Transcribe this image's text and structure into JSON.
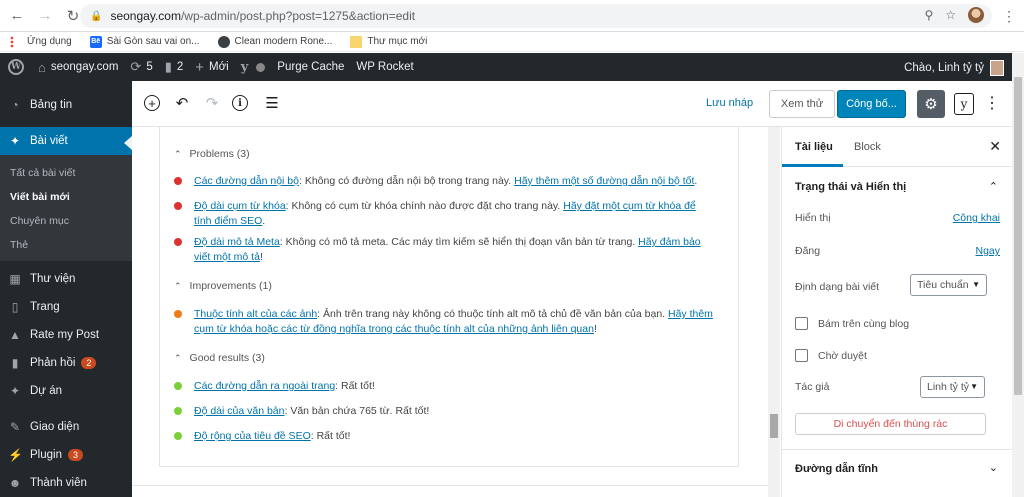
{
  "browser": {
    "url_domain": "seongay.com",
    "url_path": "/wp-admin/post.php?post=1275&action=edit",
    "bookmarks": [
      {
        "label": "Ứng dụng",
        "icon": "apps-grid-icon"
      },
      {
        "label": "Sài Gòn sau vai on...",
        "icon": "be-site-icon"
      },
      {
        "label": "Clean modern Rone...",
        "icon": "globe-icon"
      },
      {
        "label": "Thư mục mới",
        "icon": "folder-icon"
      }
    ]
  },
  "adminbar": {
    "site_name": "seongay.com",
    "updates_count": "5",
    "comments_count": "2",
    "new_label": "Mới",
    "purge_cache": "Purge Cache",
    "wp_rocket": "WP Rocket",
    "greeting": "Chào, Linh tỷ tỷ"
  },
  "sidebar": {
    "items": [
      {
        "label": "Bảng tin",
        "icon": "dashboard-icon"
      },
      {
        "label": "Bài viết",
        "icon": "pin-icon"
      },
      {
        "label": "Thư viện",
        "icon": "media-icon"
      },
      {
        "label": "Trang",
        "icon": "page-icon"
      },
      {
        "label": "Rate my Post",
        "icon": "thumbs-up-icon"
      },
      {
        "label": "Phản hồi",
        "icon": "comment-icon",
        "badge": "2"
      },
      {
        "label": "Dự án",
        "icon": "pin-icon"
      },
      {
        "label": "Giao diện",
        "icon": "brush-icon"
      },
      {
        "label": "Plugin",
        "icon": "plugin-icon",
        "badge": "3"
      },
      {
        "label": "Thành viên",
        "icon": "users-icon"
      }
    ],
    "submenu": [
      "Tất cả bài viết",
      "Viết bài mới",
      "Chuyên mục",
      "Thẻ"
    ]
  },
  "toolbar": {
    "save_draft": "Lưu nháp",
    "preview": "Xem thử",
    "publish": "Công bố..."
  },
  "seo": {
    "problems_title": "Problems (3)",
    "problems": [
      {
        "link": "Các đường dẫn nội bộ",
        "text": ": Không có đường dẫn nội bộ trong trang này. ",
        "action": "Hãy thêm một số đường dẫn nội bộ tốt",
        "end": "."
      },
      {
        "link": "Độ dài cụm từ khóa",
        "text": ": Không có cụm từ khóa chính nào được đặt cho trang này. ",
        "action": "Hãy đặt một cụm từ khóa để tính điểm SEO",
        "end": "."
      },
      {
        "link": "Độ dài mô tả Meta",
        "text": ": Không có mô tả meta. Các máy tìm kiếm sẽ hiển thị đoạn văn bản từ trang. ",
        "action": "Hãy đảm bảo viết một mô tả",
        "end": "!"
      }
    ],
    "improvements_title": "Improvements (1)",
    "improvements": [
      {
        "link": "Thuộc tính alt của các ảnh",
        "text": ": Ảnh trên trang này không có thuộc tính alt mô tả chủ đề văn bản của bạn. ",
        "action": "Hãy thêm cụm từ khóa hoặc các từ đồng nghĩa trong các thuộc tính alt của những ảnh liên quan",
        "end": "!"
      }
    ],
    "good_title": "Good results (3)",
    "good": [
      {
        "link": "Các đường dẫn ra ngoài trang",
        "text": ": Rất tốt!"
      },
      {
        "link": "Độ dài của văn bản",
        "text": ": Văn bản chứa 765 từ. Rất tốt!"
      },
      {
        "link": "Độ rộng của tiêu đề SEO",
        "text": ": Rất tốt!"
      }
    ]
  },
  "settings": {
    "tab_document": "Tài liệu",
    "tab_block": "Block",
    "status_title": "Trạng thái và Hiển thị",
    "visibility_label": "Hiển thị",
    "visibility_value": "Công khai",
    "publish_label": "Đăng",
    "publish_value": "Ngay",
    "format_label": "Định dạng bài viết",
    "format_value": "Tiêu chuẩn",
    "sticky_label": "Bám trên cùng blog",
    "pending_label": "Chờ duyệt",
    "author_label": "Tác giả",
    "author_value": "Linh tỷ tỷ",
    "trash_label": "Di chuyển đến thùng rác",
    "permalink_title": "Đường dẫn tĩnh"
  }
}
